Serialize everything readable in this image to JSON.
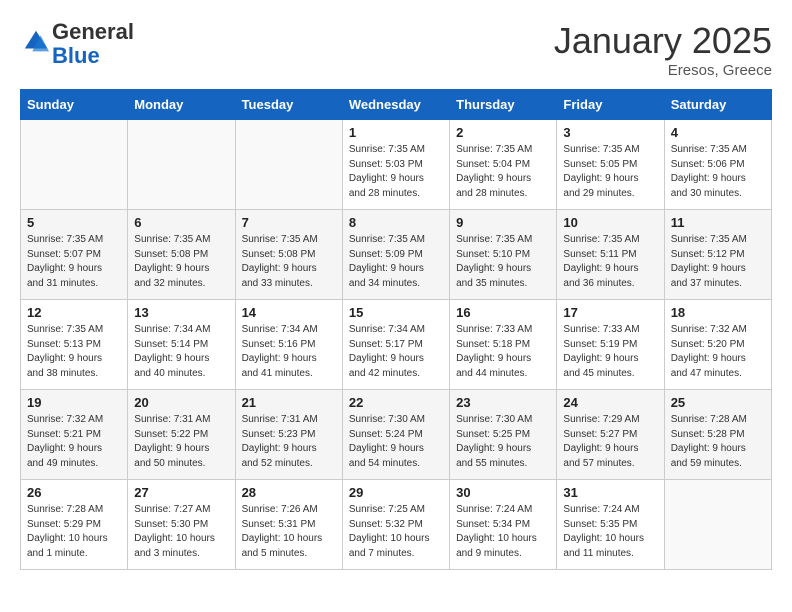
{
  "logo": {
    "general": "General",
    "blue": "Blue"
  },
  "header": {
    "month": "January 2025",
    "location": "Eresos, Greece"
  },
  "days_of_week": [
    "Sunday",
    "Monday",
    "Tuesday",
    "Wednesday",
    "Thursday",
    "Friday",
    "Saturday"
  ],
  "weeks": [
    [
      {
        "day": "",
        "info": ""
      },
      {
        "day": "",
        "info": ""
      },
      {
        "day": "",
        "info": ""
      },
      {
        "day": "1",
        "info": "Sunrise: 7:35 AM\nSunset: 5:03 PM\nDaylight: 9 hours\nand 28 minutes."
      },
      {
        "day": "2",
        "info": "Sunrise: 7:35 AM\nSunset: 5:04 PM\nDaylight: 9 hours\nand 28 minutes."
      },
      {
        "day": "3",
        "info": "Sunrise: 7:35 AM\nSunset: 5:05 PM\nDaylight: 9 hours\nand 29 minutes."
      },
      {
        "day": "4",
        "info": "Sunrise: 7:35 AM\nSunset: 5:06 PM\nDaylight: 9 hours\nand 30 minutes."
      }
    ],
    [
      {
        "day": "5",
        "info": "Sunrise: 7:35 AM\nSunset: 5:07 PM\nDaylight: 9 hours\nand 31 minutes."
      },
      {
        "day": "6",
        "info": "Sunrise: 7:35 AM\nSunset: 5:08 PM\nDaylight: 9 hours\nand 32 minutes."
      },
      {
        "day": "7",
        "info": "Sunrise: 7:35 AM\nSunset: 5:08 PM\nDaylight: 9 hours\nand 33 minutes."
      },
      {
        "day": "8",
        "info": "Sunrise: 7:35 AM\nSunset: 5:09 PM\nDaylight: 9 hours\nand 34 minutes."
      },
      {
        "day": "9",
        "info": "Sunrise: 7:35 AM\nSunset: 5:10 PM\nDaylight: 9 hours\nand 35 minutes."
      },
      {
        "day": "10",
        "info": "Sunrise: 7:35 AM\nSunset: 5:11 PM\nDaylight: 9 hours\nand 36 minutes."
      },
      {
        "day": "11",
        "info": "Sunrise: 7:35 AM\nSunset: 5:12 PM\nDaylight: 9 hours\nand 37 minutes."
      }
    ],
    [
      {
        "day": "12",
        "info": "Sunrise: 7:35 AM\nSunset: 5:13 PM\nDaylight: 9 hours\nand 38 minutes."
      },
      {
        "day": "13",
        "info": "Sunrise: 7:34 AM\nSunset: 5:14 PM\nDaylight: 9 hours\nand 40 minutes."
      },
      {
        "day": "14",
        "info": "Sunrise: 7:34 AM\nSunset: 5:16 PM\nDaylight: 9 hours\nand 41 minutes."
      },
      {
        "day": "15",
        "info": "Sunrise: 7:34 AM\nSunset: 5:17 PM\nDaylight: 9 hours\nand 42 minutes."
      },
      {
        "day": "16",
        "info": "Sunrise: 7:33 AM\nSunset: 5:18 PM\nDaylight: 9 hours\nand 44 minutes."
      },
      {
        "day": "17",
        "info": "Sunrise: 7:33 AM\nSunset: 5:19 PM\nDaylight: 9 hours\nand 45 minutes."
      },
      {
        "day": "18",
        "info": "Sunrise: 7:32 AM\nSunset: 5:20 PM\nDaylight: 9 hours\nand 47 minutes."
      }
    ],
    [
      {
        "day": "19",
        "info": "Sunrise: 7:32 AM\nSunset: 5:21 PM\nDaylight: 9 hours\nand 49 minutes."
      },
      {
        "day": "20",
        "info": "Sunrise: 7:31 AM\nSunset: 5:22 PM\nDaylight: 9 hours\nand 50 minutes."
      },
      {
        "day": "21",
        "info": "Sunrise: 7:31 AM\nSunset: 5:23 PM\nDaylight: 9 hours\nand 52 minutes."
      },
      {
        "day": "22",
        "info": "Sunrise: 7:30 AM\nSunset: 5:24 PM\nDaylight: 9 hours\nand 54 minutes."
      },
      {
        "day": "23",
        "info": "Sunrise: 7:30 AM\nSunset: 5:25 PM\nDaylight: 9 hours\nand 55 minutes."
      },
      {
        "day": "24",
        "info": "Sunrise: 7:29 AM\nSunset: 5:27 PM\nDaylight: 9 hours\nand 57 minutes."
      },
      {
        "day": "25",
        "info": "Sunrise: 7:28 AM\nSunset: 5:28 PM\nDaylight: 9 hours\nand 59 minutes."
      }
    ],
    [
      {
        "day": "26",
        "info": "Sunrise: 7:28 AM\nSunset: 5:29 PM\nDaylight: 10 hours\nand 1 minute."
      },
      {
        "day": "27",
        "info": "Sunrise: 7:27 AM\nSunset: 5:30 PM\nDaylight: 10 hours\nand 3 minutes."
      },
      {
        "day": "28",
        "info": "Sunrise: 7:26 AM\nSunset: 5:31 PM\nDaylight: 10 hours\nand 5 minutes."
      },
      {
        "day": "29",
        "info": "Sunrise: 7:25 AM\nSunset: 5:32 PM\nDaylight: 10 hours\nand 7 minutes."
      },
      {
        "day": "30",
        "info": "Sunrise: 7:24 AM\nSunset: 5:34 PM\nDaylight: 10 hours\nand 9 minutes."
      },
      {
        "day": "31",
        "info": "Sunrise: 7:24 AM\nSunset: 5:35 PM\nDaylight: 10 hours\nand 11 minutes."
      },
      {
        "day": "",
        "info": ""
      }
    ]
  ]
}
